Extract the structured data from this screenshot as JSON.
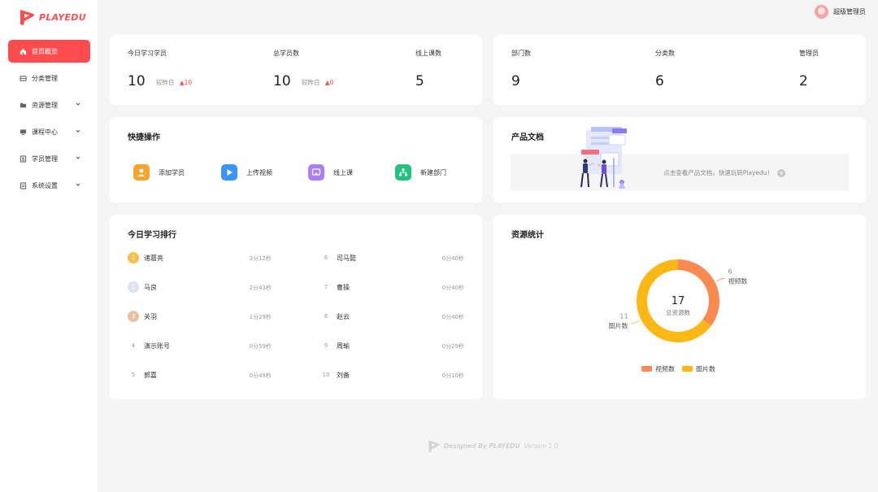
{
  "brand": {
    "name": "PLAYEDU",
    "accent": "#ff4d4f"
  },
  "header": {
    "user_name": "超级管理员"
  },
  "sidebar": {
    "items": [
      {
        "label": "首页概览",
        "icon": "home-icon",
        "active": true,
        "expandable": false
      },
      {
        "label": "分类管理",
        "icon": "category-icon",
        "active": false,
        "expandable": false
      },
      {
        "label": "资源管理",
        "icon": "folder-icon",
        "active": false,
        "expandable": true
      },
      {
        "label": "课程中心",
        "icon": "monitor-icon",
        "active": false,
        "expandable": true
      },
      {
        "label": "学员管理",
        "icon": "user-card-icon",
        "active": false,
        "expandable": true
      },
      {
        "label": "系统设置",
        "icon": "settings-icon",
        "active": false,
        "expandable": true
      }
    ]
  },
  "stats_left": {
    "today_learners": {
      "label": "今日学习学员",
      "value": "10",
      "compare_label": "较昨日",
      "compare_value": "▲10"
    },
    "total_learners": {
      "label": "总学员数",
      "value": "10",
      "compare_label": "较昨日",
      "compare_value": "▲0"
    },
    "online_courses": {
      "label": "线上课数",
      "value": "5"
    }
  },
  "stats_right": {
    "departments": {
      "label": "部门数",
      "value": "9"
    },
    "categories": {
      "label": "分类数",
      "value": "6"
    },
    "admins": {
      "label": "管理员",
      "value": "2"
    }
  },
  "quick_actions": {
    "title": "快捷操作",
    "items": [
      {
        "label": "添加学员",
        "icon": "add-user-icon",
        "color": "#f6a531"
      },
      {
        "label": "上传视频",
        "icon": "upload-video-icon",
        "color": "#3b95f7"
      },
      {
        "label": "线上课",
        "icon": "online-class-icon",
        "color": "#a97ef7"
      },
      {
        "label": "新建部门",
        "icon": "new-department-icon",
        "color": "#23c17a"
      }
    ]
  },
  "docs": {
    "title": "产品文档",
    "text": "点击查看产品文档，快速玩转Playedu！"
  },
  "ranking": {
    "title": "今日学习排行",
    "left": [
      {
        "rank": "1",
        "name": "诸葛亮",
        "time": "3分12秒",
        "medal": "gold"
      },
      {
        "rank": "2",
        "name": "马良",
        "time": "2分43秒",
        "medal": "silver"
      },
      {
        "rank": "3",
        "name": "关羽",
        "time": "1分29秒",
        "medal": "bronze"
      },
      {
        "rank": "4",
        "name": "演示账号",
        "time": "0分59秒",
        "medal": ""
      },
      {
        "rank": "5",
        "name": "郭嘉",
        "time": "0分49秒",
        "medal": ""
      }
    ],
    "right": [
      {
        "rank": "6",
        "name": "司马懿",
        "time": "0分40秒"
      },
      {
        "rank": "7",
        "name": "曹操",
        "time": "0分40秒"
      },
      {
        "rank": "8",
        "name": "赵云",
        "time": "0分40秒"
      },
      {
        "rank": "9",
        "name": "周瑜",
        "time": "0分29秒"
      },
      {
        "rank": "10",
        "name": "刘备",
        "time": "0分10秒"
      }
    ]
  },
  "resources": {
    "title": "资源统计",
    "total_value": "17",
    "total_label": "总资源数"
  },
  "chart_data": {
    "type": "pie",
    "donut": true,
    "title": "资源统计",
    "categories": [
      "视频数",
      "图片数"
    ],
    "values": [
      6,
      11
    ],
    "colors": [
      "#fa8a4f",
      "#fbb714"
    ],
    "legend": "bottom"
  },
  "footer": {
    "brand": "Designed By PLAYEDU",
    "version": "Version 1.0"
  }
}
